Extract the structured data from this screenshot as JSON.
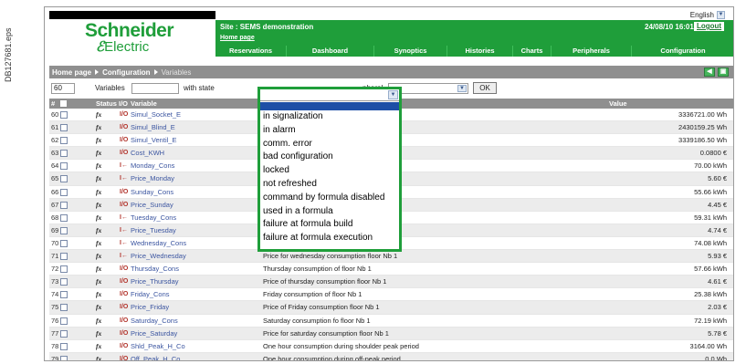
{
  "doc_id": "DB127681.eps",
  "brand": {
    "name_line1": "Schneider",
    "name_line2": "Electric",
    "color": "#1f9e3a"
  },
  "header": {
    "site": "Site : SEMS demonstration",
    "home_link": "Home page",
    "datetime": "24/08/10 16:01:30",
    "logout": "Logout",
    "language": "English"
  },
  "nav": {
    "tabs": [
      "Reservations",
      "Dashboard",
      "Synoptics",
      "Histories",
      "Charts",
      "Peripherals",
      "Configuration"
    ]
  },
  "breadcrumb": {
    "home": "Home page",
    "section": "Configuration",
    "current": "Variables"
  },
  "filter": {
    "count": "60",
    "variables_label": "Variables",
    "with_state_label": "with state",
    "peripheral_label": "pheral",
    "ok_label": "OK"
  },
  "table": {
    "headers": {
      "num": "#",
      "status": "Status",
      "io": "I/O",
      "variable": "Variable",
      "value": "Value"
    },
    "rows": [
      {
        "num": "60",
        "var": "Simul_Socket_E",
        "io": "I/O",
        "desc": "b 1 Simul",
        "val": "3336721.00 Wh"
      },
      {
        "num": "61",
        "var": "Simul_Blind_E",
        "io": "I/O",
        "desc": "ul",
        "val": "2430159.25 Wh"
      },
      {
        "num": "62",
        "var": "Simul_Ventil_E",
        "io": "I/O",
        "desc": "Simul",
        "val": "3339186.50 Wh"
      },
      {
        "num": "63",
        "var": "Cost_KWH",
        "io": "I/O",
        "desc": "",
        "val": "0.0800 €"
      },
      {
        "num": "64",
        "var": "Monday_Cons",
        "io": "I←",
        "desc": "Nb 1",
        "val": "70.00 kWh"
      },
      {
        "num": "65",
        "var": "Price_Monday",
        "io": "I←",
        "desc": "r floor Nb 1",
        "val": "5.60 €"
      },
      {
        "num": "66",
        "var": "Sunday_Cons",
        "io": "I/O",
        "desc": "Nb 1",
        "val": "55.66 kWh"
      },
      {
        "num": "67",
        "var": "Price_Sunday",
        "io": "I/O",
        "desc": "floor Nb 1",
        "val": "4.45 €"
      },
      {
        "num": "68",
        "var": "Tuesday_Cons",
        "io": "I←",
        "desc": "Nb 1",
        "val": "59.31 kWh"
      },
      {
        "num": "69",
        "var": "Price_Tuesday",
        "io": "I←",
        "desc": "floor Nb 1",
        "val": "4.74 €"
      },
      {
        "num": "70",
        "var": "Wednesday_Cons",
        "io": "I←",
        "desc": "Wednesday consumption of floor Nb 1",
        "val": "74.08 kWh"
      },
      {
        "num": "71",
        "var": "Price_Wednesday",
        "io": "I←",
        "desc": "Price for wednesday consumption floor Nb 1",
        "val": "5.93 €"
      },
      {
        "num": "72",
        "var": "Thursday_Cons",
        "io": "I/O",
        "desc": "Thursday consumption of floor Nb 1",
        "val": "57.66 kWh"
      },
      {
        "num": "73",
        "var": "Price_Thursday",
        "io": "I/O",
        "desc": "Price of thursday consumption floor Nb 1",
        "val": "4.61 €"
      },
      {
        "num": "74",
        "var": "Friday_Cons",
        "io": "I/O",
        "desc": "Friday consumption of floor Nb 1",
        "val": "25.38 kWh"
      },
      {
        "num": "75",
        "var": "Price_Friday",
        "io": "I/O",
        "desc": "Price of Friday consumption floor Nb 1",
        "val": "2.03 €"
      },
      {
        "num": "76",
        "var": "Saturday_Cons",
        "io": "I/O",
        "desc": "Saturday consumption fo floor Nb 1",
        "val": "72.19 kWh"
      },
      {
        "num": "77",
        "var": "Price_Saturday",
        "io": "I/O",
        "desc": "Price for saturday consumption floor Nb 1",
        "val": "5.78 €"
      },
      {
        "num": "78",
        "var": "Shld_Peak_H_Co",
        "io": "I/O",
        "desc": "One hour consumption during shoulder peak period",
        "val": "3164.00 Wh"
      },
      {
        "num": "79",
        "var": "Off_Peak_H_Co",
        "io": "I/O",
        "desc": "One hour consumption during off-peak period",
        "val": "0.0 Wh"
      }
    ]
  },
  "state_dropdown": {
    "options": [
      "in signalization",
      "in alarm",
      "comm. error",
      "bad configuration",
      "locked",
      "not refreshed",
      "command by formula disabled",
      "used in a formula",
      "failure at formula build",
      "failure at formula execution"
    ]
  }
}
